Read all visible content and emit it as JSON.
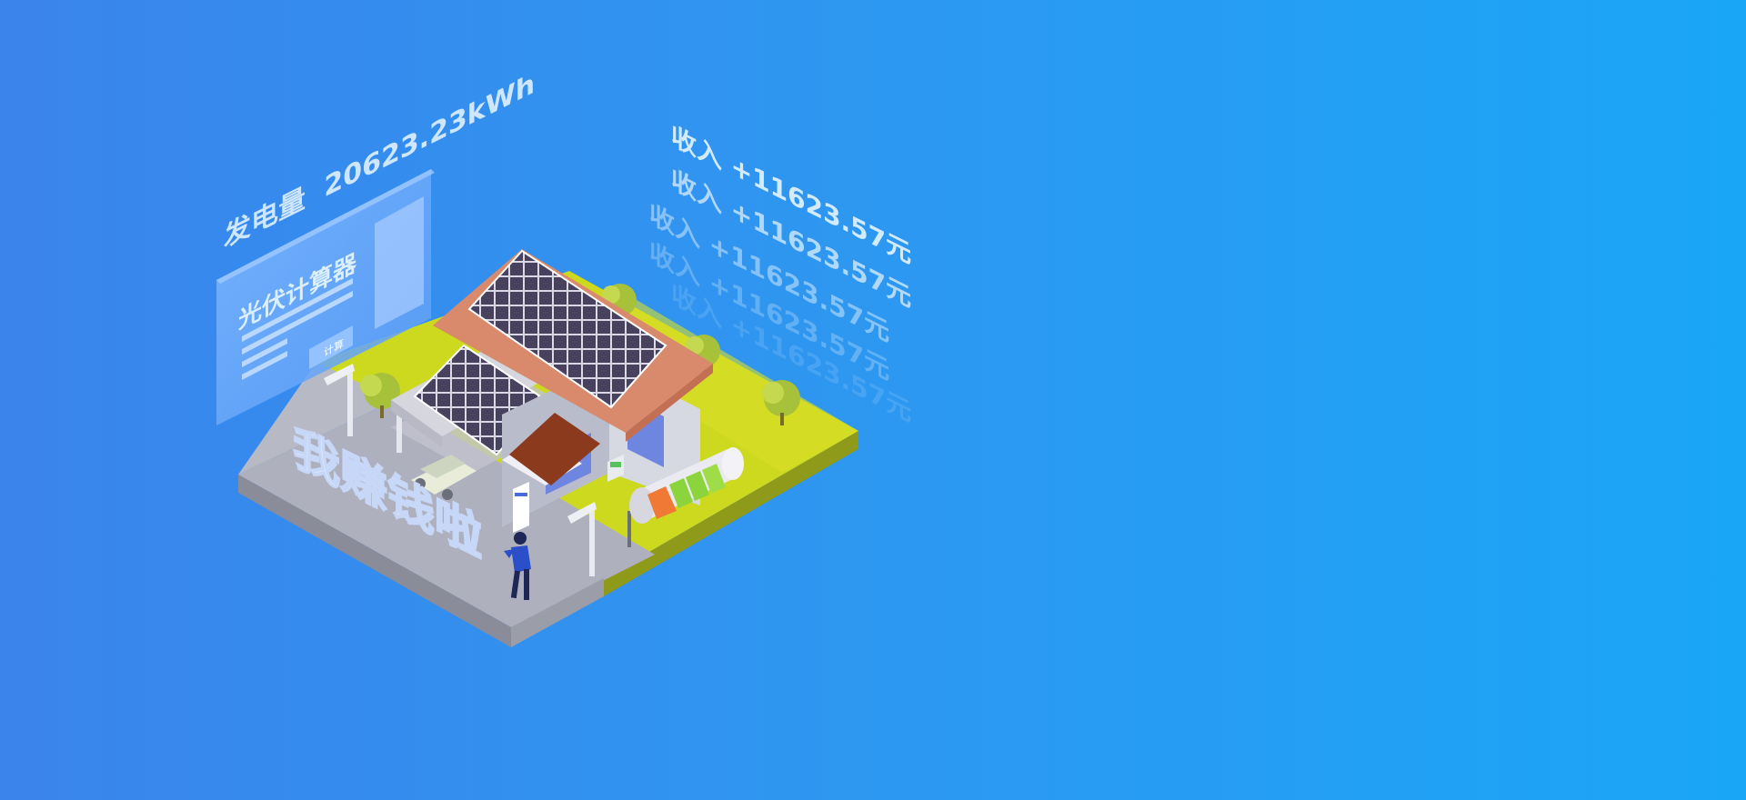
{
  "banner": {
    "generation": {
      "label": "发电量",
      "value": "20623.23kWh"
    },
    "calculator": {
      "title": "光伏计算器",
      "button_label": "计算"
    },
    "slogan": "我赚钱啦",
    "income_lines": [
      "收入 +11623.57元",
      "收入 +11623.57元",
      "收入 +11623.57元",
      "收入 +11623.57元",
      "收入 +11623.57元"
    ],
    "colors": {
      "bg_left": "#3a84ec",
      "bg_right": "#1aa6f7",
      "panel": "#6aa9ff",
      "grass": "#cbd81e",
      "pavement": "#aeb0bd",
      "roof": "#d98a6c",
      "solar_panel": "#4a4562",
      "battery_green": "#8bd43c",
      "battery_orange": "#f07a35"
    }
  }
}
